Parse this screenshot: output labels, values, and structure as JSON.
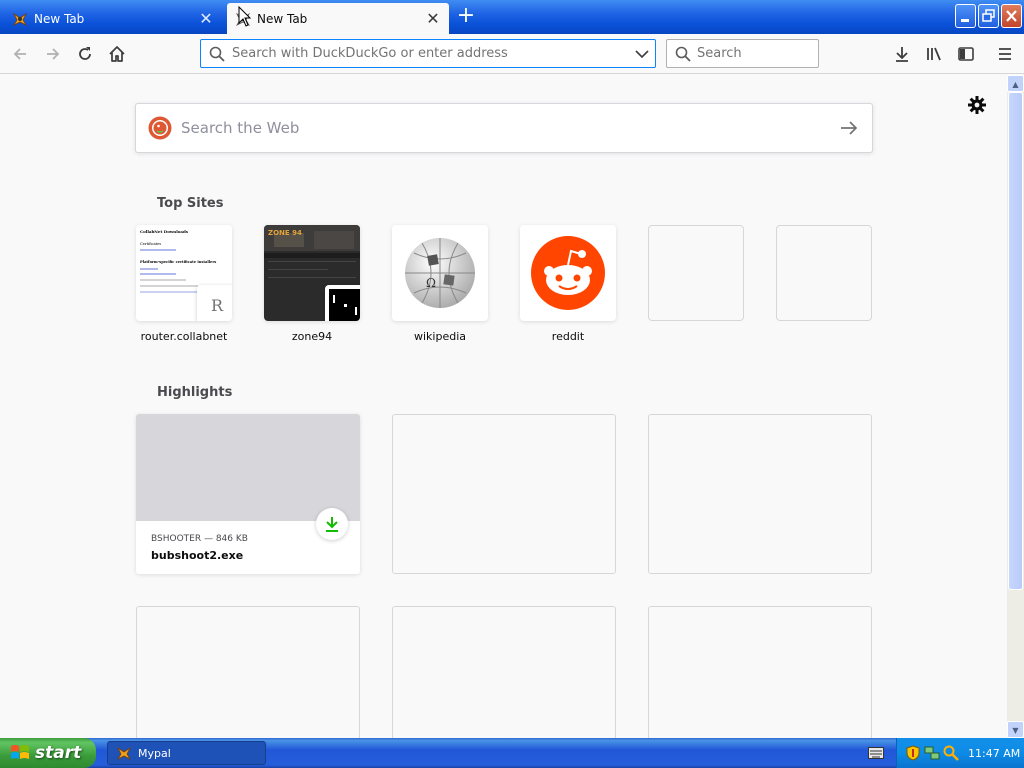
{
  "browser": {
    "tabs": [
      {
        "title": "New Tab",
        "active": false
      },
      {
        "title": "New Tab",
        "active": true
      }
    ],
    "window_buttons": {
      "minimize": "minimize-icon",
      "maximize": "restore-icon",
      "close": "close-icon"
    }
  },
  "navbar": {
    "url_placeholder": "Search with DuckDuckGo or enter address",
    "search_placeholder": "Search"
  },
  "newtab": {
    "web_search_placeholder": "Search the Web",
    "top_sites_title": "Top Sites",
    "top_sites": [
      {
        "label": "router.collabnet",
        "badge": "R"
      },
      {
        "label": "zone94"
      },
      {
        "label": "wikipedia"
      },
      {
        "label": "reddit"
      },
      {
        "label": ""
      },
      {
        "label": ""
      }
    ],
    "highlights_title": "Highlights",
    "highlights": [
      {
        "context": "BSHOOTER — 846 KB",
        "name": "bubshoot2.exe"
      }
    ],
    "thumb_router": {
      "heading": "CollabNet Downloads",
      "line1": "Certificates",
      "line2": "Platform-specific certificate installers"
    },
    "thumb_zone94": {
      "logo": "ZONE 94"
    },
    "wiki_glyph": "Ω"
  },
  "taskbar": {
    "start_label": "start",
    "task": "Mypal",
    "clock": "11:47 AM"
  },
  "colors": {
    "accent": "#0a84ff",
    "reddit": "#ff4500",
    "download_green": "#12bc00",
    "xp_blue": "#245edb"
  }
}
